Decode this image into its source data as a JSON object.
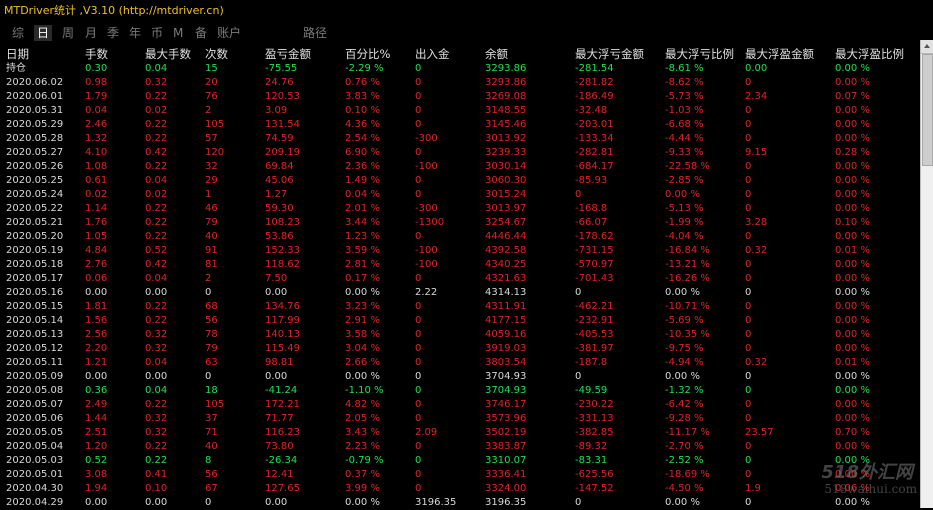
{
  "window": {
    "title": "MTDriver统计 ,V3.10 (http://mtdriver.cn)"
  },
  "tabs": [
    {
      "label": "综",
      "active": false
    },
    {
      "label": "日",
      "active": true
    },
    {
      "label": "周",
      "active": false
    },
    {
      "label": "月",
      "active": false
    },
    {
      "label": "季",
      "active": false
    },
    {
      "label": "年",
      "active": false
    },
    {
      "label": "币",
      "active": false
    },
    {
      "label": "M",
      "active": false
    },
    {
      "label": "备",
      "active": false
    },
    {
      "label": "账户",
      "active": false
    },
    {
      "label": "路径",
      "active": false
    }
  ],
  "columns": [
    "日期",
    "手数",
    "最大手数",
    "次数",
    "盈亏金额",
    "百分比%",
    "出入金",
    "余额",
    "最大浮亏金额",
    "最大浮亏比例",
    "最大浮盈金额",
    "最大浮盈比例"
  ],
  "colors": {
    "positive": "#20e050",
    "negative": "#e02424",
    "neutral": "#d8d8d8",
    "title": "#f0c020"
  },
  "rows": [
    {
      "cells": [
        "持仓",
        "0.30",
        "0.04",
        "15",
        "-75.55",
        "-2.29 %",
        "0",
        "3293.86",
        "-281.54",
        "-8.61 %",
        "0.00",
        "0.00 %"
      ],
      "tone": "g"
    },
    {
      "cells": [
        "2020.06.02",
        "0.98",
        "0.32",
        "20",
        "24.76",
        "0.76 %",
        "0",
        "3293.86",
        "-281.82",
        "-8.62 %",
        "0",
        "0.00 %"
      ],
      "tone": "r"
    },
    {
      "cells": [
        "2020.06.01",
        "1.79",
        "0.22",
        "76",
        "120.53",
        "3.83 %",
        "0",
        "3269.08",
        "-186.49",
        "-5.73 %",
        "2.34",
        "0.07 %"
      ],
      "tone": "r"
    },
    {
      "cells": [
        "2020.05.31",
        "0.04",
        "0.02",
        "2",
        "3.09",
        "0.10 %",
        "0",
        "3148.55",
        "-32.48",
        "-1.03 %",
        "0",
        "0.00 %"
      ],
      "tone": "r"
    },
    {
      "cells": [
        "2020.05.29",
        "2.46",
        "0.22",
        "105",
        "131.54",
        "4.36 %",
        "0",
        "3145.46",
        "-203.01",
        "-6.68 %",
        "0",
        "0.00 %"
      ],
      "tone": "r"
    },
    {
      "cells": [
        "2020.05.28",
        "1.32",
        "0.22",
        "57",
        "74.59",
        "2.54 %",
        "-300",
        "3013.92",
        "-133.34",
        "-4.44 %",
        "0",
        "0.00 %"
      ],
      "tone": "r"
    },
    {
      "cells": [
        "2020.05.27",
        "4.10",
        "0.42",
        "120",
        "209.19",
        "6.90 %",
        "0",
        "3239.33",
        "-282.81",
        "-9.33 %",
        "9.15",
        "0.28 %"
      ],
      "tone": "r"
    },
    {
      "cells": [
        "2020.05.26",
        "1.08",
        "0.22",
        "32",
        "69.84",
        "2.36 %",
        "-100",
        "3030.14",
        "-684.17",
        "-22.58 %",
        "0",
        "0.00 %"
      ],
      "tone": "r"
    },
    {
      "cells": [
        "2020.05.25",
        "0.61",
        "0.04",
        "29",
        "45.06",
        "1.49 %",
        "0",
        "3060.30",
        "-85.93",
        "-2.85 %",
        "0",
        "0.00 %"
      ],
      "tone": "r"
    },
    {
      "cells": [
        "2020.05.24",
        "0.02",
        "0.02",
        "1",
        "1.27",
        "0.04 %",
        "0",
        "3015.24",
        "0",
        "0.00 %",
        "0",
        "0.00 %"
      ],
      "tone": "r"
    },
    {
      "cells": [
        "2020.05.22",
        "1.14",
        "0.22",
        "46",
        "59.30",
        "2.01 %",
        "-300",
        "3013.97",
        "-168.8",
        "-5.13 %",
        "0",
        "0.00 %"
      ],
      "tone": "r"
    },
    {
      "cells": [
        "2020.05.21",
        "1.76",
        "0.22",
        "79",
        "108.23",
        "3.44 %",
        "-1300",
        "3254.67",
        "-66.07",
        "-1.99 %",
        "3.28",
        "0.10 %"
      ],
      "tone": "r"
    },
    {
      "cells": [
        "2020.05.20",
        "1.05",
        "0.22",
        "40",
        "53.86",
        "1.23 %",
        "0",
        "4446.44",
        "-178.62",
        "-4.04 %",
        "0",
        "0.00 %"
      ],
      "tone": "r"
    },
    {
      "cells": [
        "2020.05.19",
        "4.84",
        "0.52",
        "91",
        "152.33",
        "3.59 %",
        "-100",
        "4392.58",
        "-731.15",
        "-16.84 %",
        "0.32",
        "0.01 %"
      ],
      "tone": "r"
    },
    {
      "cells": [
        "2020.05.18",
        "2.76",
        "0.42",
        "81",
        "118.62",
        "2.81 %",
        "-100",
        "4340.25",
        "-570.97",
        "-13.21 %",
        "0",
        "0.00 %"
      ],
      "tone": "r"
    },
    {
      "cells": [
        "2020.05.17",
        "0.06",
        "0.04",
        "2",
        "7.50",
        "0.17 %",
        "0",
        "4321.63",
        "-701.43",
        "-16.26 %",
        "0",
        "0.00 %"
      ],
      "tone": "r"
    },
    {
      "cells": [
        "2020.05.16",
        "0.00",
        "0.00",
        "0",
        "0.00",
        "0.00 %",
        "2.22",
        "4314.13",
        "0",
        "0.00 %",
        "0",
        "0.00 %"
      ],
      "tone": "w"
    },
    {
      "cells": [
        "2020.05.15",
        "1.81",
        "0.22",
        "68",
        "134.76",
        "3.23 %",
        "0",
        "4311.91",
        "-462.21",
        "-10.71 %",
        "0",
        "0.00 %"
      ],
      "tone": "r"
    },
    {
      "cells": [
        "2020.05.14",
        "1.56",
        "0.22",
        "56",
        "117.99",
        "2.91 %",
        "0",
        "4177.15",
        "-232.91",
        "-5.69 %",
        "0",
        "0.00 %"
      ],
      "tone": "r"
    },
    {
      "cells": [
        "2020.05.13",
        "2.56",
        "0.32",
        "78",
        "140.13",
        "3.58 %",
        "0",
        "4059.16",
        "-405.53",
        "-10.35 %",
        "0",
        "0.00 %"
      ],
      "tone": "r"
    },
    {
      "cells": [
        "2020.05.12",
        "2.20",
        "0.32",
        "79",
        "115.49",
        "3.04 %",
        "0",
        "3919.03",
        "-381.97",
        "-9.75 %",
        "0",
        "0.00 %"
      ],
      "tone": "r"
    },
    {
      "cells": [
        "2020.05.11",
        "1.21",
        "0.04",
        "63",
        "98.81",
        "2.66 %",
        "0",
        "3803.54",
        "-187.8",
        "-4.94 %",
        "0.32",
        "0.01 %"
      ],
      "tone": "r"
    },
    {
      "cells": [
        "2020.05.09",
        "0.00",
        "0.00",
        "0",
        "0.00",
        "0.00 %",
        "0",
        "3704.93",
        "0",
        "0.00 %",
        "0",
        "0.00 %"
      ],
      "tone": "w"
    },
    {
      "cells": [
        "2020.05.08",
        "0.36",
        "0.04",
        "18",
        "-41.24",
        "-1.10 %",
        "0",
        "3704.93",
        "-49.59",
        "-1.32 %",
        "0",
        "0.00 %"
      ],
      "tone": "g"
    },
    {
      "cells": [
        "2020.05.07",
        "2.49",
        "0.22",
        "105",
        "172.21",
        "4.82 %",
        "0",
        "3746.17",
        "-230.22",
        "-6.42 %",
        "0",
        "0.00 %"
      ],
      "tone": "r"
    },
    {
      "cells": [
        "2020.05.06",
        "1.44",
        "0.32",
        "37",
        "71.77",
        "2.05 %",
        "0",
        "3573.96",
        "-331.13",
        "-9.28 %",
        "0",
        "0.00 %"
      ],
      "tone": "r"
    },
    {
      "cells": [
        "2020.05.05",
        "2.51",
        "0.32",
        "71",
        "116.23",
        "3.43 %",
        "2.09",
        "3502.19",
        "-382.85",
        "-11.17 %",
        "23.57",
        "0.70 %"
      ],
      "tone": "r"
    },
    {
      "cells": [
        "2020.05.04",
        "1.20",
        "0.22",
        "40",
        "73.80",
        "2.23 %",
        "0",
        "3383.87",
        "-89.32",
        "-2.70 %",
        "0",
        "0.00 %"
      ],
      "tone": "r"
    },
    {
      "cells": [
        "2020.05.03",
        "0.52",
        "0.22",
        "8",
        "-26.34",
        "-0.79 %",
        "0",
        "3310.07",
        "-83.31",
        "-2.52 %",
        "0",
        "0.00 %"
      ],
      "tone": "g"
    },
    {
      "cells": [
        "2020.05.01",
        "3.08",
        "0.41",
        "56",
        "12.41",
        "0.37 %",
        "0",
        "3336.41",
        "-625.56",
        "-18.69 %",
        "0",
        "0.00 %"
      ],
      "tone": "r"
    },
    {
      "cells": [
        "2020.04.30",
        "1.94",
        "0.10",
        "67",
        "127.65",
        "3.99 %",
        "0",
        "3324.00",
        "-147.52",
        "-4.50 %",
        "1.9",
        "0.06 %"
      ],
      "tone": "r"
    },
    {
      "cells": [
        "2020.04.29",
        "0.00",
        "0.00",
        "0",
        "0.00",
        "0.00 %",
        "3196.35",
        "3196.35",
        "0",
        "0.00 %",
        "0",
        "0.00 %"
      ],
      "tone": "w"
    }
  ],
  "watermark": {
    "line1": "518外汇网",
    "line2": "518waihui.com"
  },
  "scrollbar": {
    "position_fraction": 0
  }
}
